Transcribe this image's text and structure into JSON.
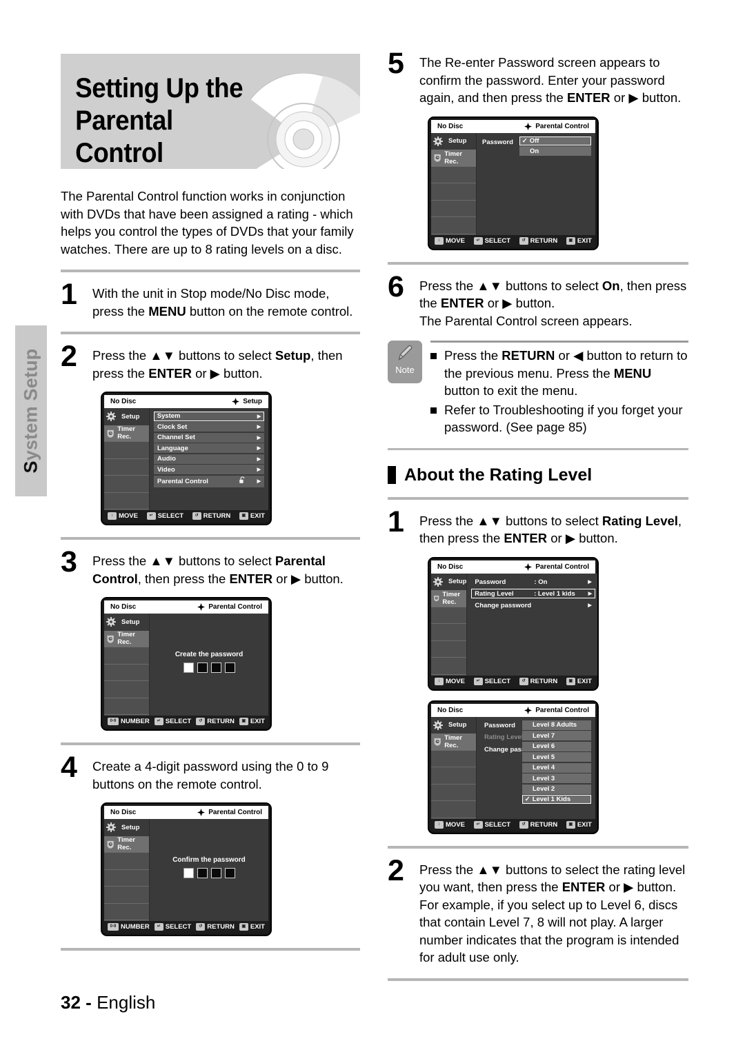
{
  "side_tab": {
    "label": "System Setup",
    "first_letter": "S",
    "rest": "ystem Setup"
  },
  "banner": {
    "title_line1": "Setting Up the Parental",
    "title_line2": "Control"
  },
  "intro": "The Parental Control function works in conjunction with DVDs that have been assigned a rating - which helps you control the types of DVDs that your family watches. There are up to 8 rating levels on a disc.",
  "steps_left": [
    {
      "num": "1",
      "text_html": "With the unit in Stop mode/No Disc mode, press the <b>MENU</b> button on the remote control."
    },
    {
      "num": "2",
      "text_html": "Press the ▲▼ buttons to select <b>Setup</b>, then press the <b>ENTER</b> or ▶ button."
    },
    {
      "num": "3",
      "text_html": "Press the ▲▼ buttons to select <b>Parental Control</b>, then press the <b>ENTER</b> or ▶ button."
    },
    {
      "num": "4",
      "text_html": "Create a 4-digit password using the 0 to 9 buttons on the remote control."
    }
  ],
  "steps_right": [
    {
      "num": "5",
      "text_html": "The Re-enter Password screen appears to confirm the password. Enter your password again, and then press the <b>ENTER</b> or ▶ button."
    },
    {
      "num": "6",
      "text_html": "Press the ▲▼ buttons to select <b>On</b>, then press the <b>ENTER</b> or ▶ button.<br>The Parental Control screen appears."
    }
  ],
  "note": {
    "label": "Note",
    "items_html": [
      "Press the <b>RETURN</b> or ◀ button to return to the previous menu. Press the <b>MENU</b> button to exit the menu.",
      "Refer to Troubleshooting if you forget your password. (See page 85)"
    ]
  },
  "rating_section": {
    "heading": "About the Rating Level",
    "steps": [
      {
        "num": "1",
        "text_html": "Press the ▲▼ buttons to select <b>Rating Level</b>, then press the <b>ENTER</b> or ▶ button."
      },
      {
        "num": "2",
        "text_html": "Press the ▲▼ buttons to select the rating level you want, then press the <b>ENTER</b> or ▶ button.<br>For example, if you select up to Level 6, discs that contain Level 7, 8 will not play. A larger number indicates that the program is intended for adult use only."
      }
    ]
  },
  "screens": {
    "setup_menu": {
      "status": "No Disc",
      "title": "Setup",
      "sidebar": [
        "Setup",
        "Timer Rec."
      ],
      "items": [
        {
          "label": "System",
          "selected": true
        },
        {
          "label": "Clock Set",
          "selected": false
        },
        {
          "label": "Channel Set",
          "selected": false
        },
        {
          "label": "Language",
          "selected": false
        },
        {
          "label": "Audio",
          "selected": false
        },
        {
          "label": "Video",
          "selected": false
        },
        {
          "label": "Parental Control",
          "selected": false,
          "lock": true
        }
      ],
      "footer": [
        {
          "icon": "updown",
          "label": "MOVE"
        },
        {
          "icon": "enter",
          "label": "SELECT"
        },
        {
          "icon": "return",
          "label": "RETURN"
        },
        {
          "icon": "exit",
          "label": "EXIT"
        }
      ]
    },
    "create_password": {
      "status": "No Disc",
      "title": "Parental Control",
      "sidebar": [
        "Setup",
        "Timer Rec."
      ],
      "prompt": "Create the password",
      "boxes": [
        "empty",
        "filled",
        "filled",
        "filled"
      ],
      "footer": [
        {
          "icon": "0-9",
          "label": "NUMBER"
        },
        {
          "icon": "enter",
          "label": "SELECT"
        },
        {
          "icon": "return",
          "label": "RETURN"
        },
        {
          "icon": "exit",
          "label": "EXIT"
        }
      ]
    },
    "confirm_password": {
      "status": "No Disc",
      "title": "Parental Control",
      "sidebar": [
        "Setup",
        "Timer Rec."
      ],
      "prompt": "Confirm the password",
      "boxes": [
        "empty",
        "filled",
        "filled",
        "filled"
      ],
      "footer": [
        {
          "icon": "0-9",
          "label": "NUMBER"
        },
        {
          "icon": "enter",
          "label": "SELECT"
        },
        {
          "icon": "return",
          "label": "RETURN"
        },
        {
          "icon": "exit",
          "label": "EXIT"
        }
      ]
    },
    "password_onoff": {
      "status": "No Disc",
      "title": "Parental Control",
      "sidebar": [
        "Setup",
        "Timer Rec."
      ],
      "field_label": "Password",
      "options": [
        {
          "label": "Off",
          "checked": true,
          "selected": true
        },
        {
          "label": "On",
          "checked": false,
          "selected": false
        }
      ],
      "footer": [
        {
          "icon": "updown",
          "label": "MOVE"
        },
        {
          "icon": "enter",
          "label": "SELECT"
        },
        {
          "icon": "return",
          "label": "RETURN"
        },
        {
          "icon": "exit",
          "label": "EXIT"
        }
      ]
    },
    "parental_menu": {
      "status": "No Disc",
      "title": "Parental Control",
      "sidebar": [
        "Setup",
        "Timer Rec."
      ],
      "rows": [
        {
          "key": "Password",
          "value": ": On",
          "selected": false
        },
        {
          "key": "Rating Level",
          "value": ": Level 1 kids",
          "selected": true
        },
        {
          "key": "Change password",
          "value": "",
          "selected": false
        }
      ],
      "footer": [
        {
          "icon": "updown",
          "label": "MOVE"
        },
        {
          "icon": "enter",
          "label": "SELECT"
        },
        {
          "icon": "return",
          "label": "RETURN"
        },
        {
          "icon": "exit",
          "label": "EXIT"
        }
      ]
    },
    "rating_levels": {
      "status": "No Disc",
      "title": "Parental Control",
      "sidebar": [
        "Setup",
        "Timer Rec."
      ],
      "rows": [
        {
          "key": "Password",
          "dim": false
        },
        {
          "key": "Rating Level",
          "dim": true
        },
        {
          "key": "Change password",
          "dim": false
        }
      ],
      "levels": [
        {
          "label": "Level 8 Adults",
          "checked": false,
          "selected": false
        },
        {
          "label": "Level 7",
          "checked": false,
          "selected": false
        },
        {
          "label": "Level 6",
          "checked": false,
          "selected": false
        },
        {
          "label": "Level 5",
          "checked": false,
          "selected": false
        },
        {
          "label": "Level 4",
          "checked": false,
          "selected": false
        },
        {
          "label": "Level 3",
          "checked": false,
          "selected": false
        },
        {
          "label": "Level 2",
          "checked": false,
          "selected": false
        },
        {
          "label": "Level 1 Kids",
          "checked": true,
          "selected": true
        }
      ],
      "footer": [
        {
          "icon": "updown",
          "label": "MOVE"
        },
        {
          "icon": "enter",
          "label": "SELECT"
        },
        {
          "icon": "return",
          "label": "RETURN"
        },
        {
          "icon": "exit",
          "label": "EXIT"
        }
      ]
    }
  },
  "footer": {
    "page": "32",
    "dash": "-",
    "language": "English"
  },
  "colors": {
    "banner_bg": "#cfcfcf",
    "rule": "#b6b6b6",
    "tv_bg": "#3a3a3a",
    "tv_sidebar": "#4a4a4a",
    "highlight": "#ffffff"
  }
}
